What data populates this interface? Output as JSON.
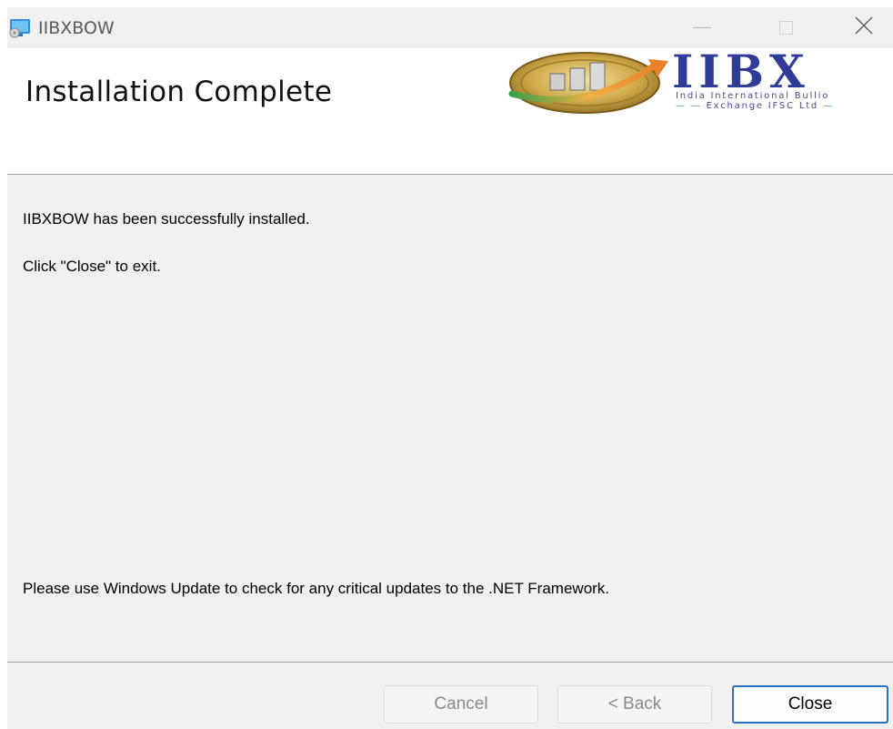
{
  "window": {
    "title": "IIBXBOW",
    "controls": {
      "minimize": "minimize",
      "maximize": "maximize",
      "close": "close"
    }
  },
  "header": {
    "title": "Installation Complete",
    "logo": {
      "brand": "IIBX",
      "tagline_line1": "India International Bullio",
      "tagline_line2": "Exchange IFSC Ltd"
    }
  },
  "body": {
    "message_installed": "IIBXBOW has been successfully installed.",
    "message_close": "Click \"Close\" to exit.",
    "message_update": "Please use Windows Update to check for any critical updates to the .NET Framework."
  },
  "footer": {
    "cancel_label": "Cancel",
    "back_label": "< Back",
    "close_label": "Close"
  },
  "colors": {
    "accent": "#2c6fc0",
    "brand_blue": "#2f3b97",
    "logo_gold": "#c9a93a",
    "logo_orange": "#e8822a",
    "logo_green": "#3aa14a"
  },
  "icons": {
    "app": "installer-icon",
    "minimize": "minimize-icon",
    "maximize": "maximize-icon",
    "close": "close-icon"
  }
}
